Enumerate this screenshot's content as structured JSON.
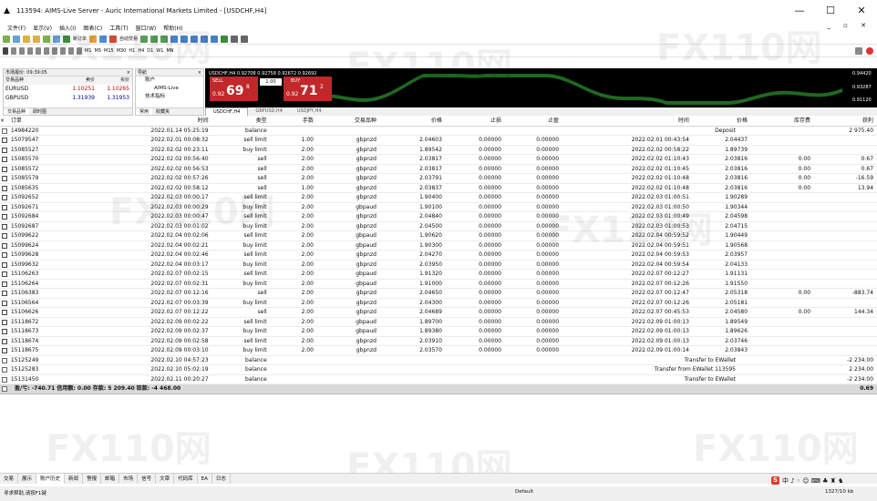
{
  "window": {
    "title": "113594: AIMS-Live Server - Auric International Markets Limited - [USDCHF,H4]",
    "controls": [
      "—",
      "☐",
      "✕"
    ]
  },
  "menu": {
    "items": [
      "文件(F)",
      "显示(V)",
      "插入(I)",
      "图表(C)",
      "工具(T)",
      "窗口(W)",
      "帮助(H)"
    ],
    "mdi": "_ ▫ ✕"
  },
  "toolbar": {
    "new_order": "新订单",
    "auto_trade": "自动交易",
    "timeframes": [
      "M1",
      "M5",
      "M15",
      "M30",
      "H1",
      "H4",
      "D1",
      "W1",
      "MN"
    ]
  },
  "market_watch": {
    "header": "市场报价: 09:39:05",
    "cols": [
      "交易品种",
      "卖价",
      "买价"
    ],
    "rows": [
      {
        "sym": "EURUSD",
        "bid": "1.10251",
        "ask": "1.10265"
      },
      {
        "sym": "GBPUSD",
        "bid": "1.31939",
        "ask": "1.31953"
      }
    ],
    "tabs": [
      "交易品种",
      "即时图"
    ]
  },
  "navigator": {
    "header": "导航",
    "items": [
      "AIMS-Live",
      "账户",
      "技术指标"
    ],
    "tabs": [
      "常用",
      "收藏夹"
    ]
  },
  "chart": {
    "info": "USDCHF,H4 0.92708 0.92758 0.92672 0.92692",
    "sell_label": "SELL",
    "buy_label": "BUY",
    "lot": "1.00",
    "sell_price_small": "0.92",
    "sell_price_big": "69",
    "sell_price_sup": "8",
    "buy_price_small": "0.92",
    "buy_price_big": "71",
    "buy_price_sup": "2",
    "price_labels": [
      "0.94420",
      "0.93287",
      "0.91120"
    ],
    "tabs": [
      "USDCHF,H4",
      "GBPUSD,H4",
      "USDJPY,H4"
    ]
  },
  "terminal": {
    "headers": {
      "order": "订单",
      "time1": "时间",
      "type": "类型",
      "lots": "手数",
      "symbol": "交易品种",
      "price": "价格",
      "sl": "止损",
      "tp": "止盈",
      "time2": "时间",
      "cprice": "价格",
      "swap": "库存费",
      "profit": "获利"
    },
    "rows": [
      {
        "order": "14984220",
        "t1": "2022.01.14 05:25:19",
        "type": "balance",
        "lots": "",
        "sym": "",
        "price": "",
        "sl": "",
        "tp": "",
        "t2": "",
        "cp": "",
        "sw": "",
        "pr": "2 975.40",
        "comment": "Deposit",
        "kind": "bal"
      },
      {
        "order": "15079547",
        "t1": "2022.02.01 00:08:32",
        "type": "sell limit",
        "lots": "1.00",
        "sym": "gbpnzd",
        "price": "2.04603",
        "sl": "0.00000",
        "tp": "0.00000",
        "t2": "2022.02.01 00:43:54",
        "cp": "2.04437",
        "sw": "",
        "pr": "",
        "comment": "",
        "kind": "ord"
      },
      {
        "order": "15085527",
        "t1": "2022.02.02 00:23:11",
        "type": "buy limit",
        "lots": "2.00",
        "sym": "gbpnzd",
        "price": "1.89542",
        "sl": "0.00000",
        "tp": "0.00000",
        "t2": "2022.02.02 00:58:22",
        "cp": "1.89739",
        "sw": "",
        "pr": "",
        "comment": "",
        "kind": "ord"
      },
      {
        "order": "15085570",
        "t1": "2022.02.02 00:56:40",
        "type": "sell",
        "lots": "2.00",
        "sym": "gbpnzd",
        "price": "2.03817",
        "sl": "0.00000",
        "tp": "0.00000",
        "t2": "2022.02.02 01:10:43",
        "cp": "2.03816",
        "sw": "0.00",
        "pr": "0.67",
        "comment": "",
        "kind": "ord"
      },
      {
        "order": "15085572",
        "t1": "2022.02.02 00:56:53",
        "type": "sell",
        "lots": "2.00",
        "sym": "gbpnzd",
        "price": "2.03817",
        "sl": "0.00000",
        "tp": "0.00000",
        "t2": "2022.02.02 01:10:45",
        "cp": "2.03816",
        "sw": "0.00",
        "pr": "0.67",
        "comment": "",
        "kind": "ord"
      },
      {
        "order": "15085579",
        "t1": "2022.02.02 00:57:26",
        "type": "sell",
        "lots": "2.00",
        "sym": "gbpnzd",
        "price": "2.03791",
        "sl": "0.00000",
        "tp": "0.00000",
        "t2": "2022.02.02 01:10:48",
        "cp": "2.03816",
        "sw": "0.00",
        "pr": "-16.59",
        "comment": "",
        "kind": "ord"
      },
      {
        "order": "15085635",
        "t1": "2022.02.02 00:58:12",
        "type": "sell",
        "lots": "1.00",
        "sym": "gbpnzd",
        "price": "2.03837",
        "sl": "0.00000",
        "tp": "0.00000",
        "t2": "2022.02.02 01:10:48",
        "cp": "2.03816",
        "sw": "0.00",
        "pr": "13.94",
        "comment": "",
        "kind": "ord"
      },
      {
        "order": "15092652",
        "t1": "2022.02.03 00:00:17",
        "type": "sell limit",
        "lots": "2.00",
        "sym": "gbpnzd",
        "price": "1.90400",
        "sl": "0.00000",
        "tp": "0.00000",
        "t2": "2022.02.03 01:00:51",
        "cp": "1.90289",
        "sw": "",
        "pr": "",
        "comment": "",
        "kind": "ord"
      },
      {
        "order": "15092671",
        "t1": "2022.02.03 00:00:29",
        "type": "buy limit",
        "lots": "2.00",
        "sym": "gbpaud",
        "price": "1.90100",
        "sl": "0.00000",
        "tp": "0.00000",
        "t2": "2022.02.03 01:00:50",
        "cp": "1.90344",
        "sw": "",
        "pr": "",
        "comment": "",
        "kind": "ord"
      },
      {
        "order": "15092684",
        "t1": "2022.02.03 00:00:47",
        "type": "sell limit",
        "lots": "2.00",
        "sym": "gbpnzd",
        "price": "2.04840",
        "sl": "0.00000",
        "tp": "0.00000",
        "t2": "2022.02.03 01:00:49",
        "cp": "2.04598",
        "sw": "",
        "pr": "",
        "comment": "",
        "kind": "ord"
      },
      {
        "order": "15092687",
        "t1": "2022.02.03 00:01:02",
        "type": "buy limit",
        "lots": "2.00",
        "sym": "gbpnzd",
        "price": "2.04500",
        "sl": "0.00000",
        "tp": "0.00000",
        "t2": "2022.02.03 01:00:53",
        "cp": "2.04715",
        "sw": "",
        "pr": "",
        "comment": "",
        "kind": "ord"
      },
      {
        "order": "15099622",
        "t1": "2022.02.04 00:02:06",
        "type": "sell limit",
        "lots": "2.00",
        "sym": "gbpaud",
        "price": "1.90620",
        "sl": "0.00000",
        "tp": "0.00000",
        "t2": "2022.02.04 00:59:52",
        "cp": "1.90449",
        "sw": "",
        "pr": "",
        "comment": "",
        "kind": "ord"
      },
      {
        "order": "15099624",
        "t1": "2022.02.04 00:02:21",
        "type": "buy limit",
        "lots": "2.00",
        "sym": "gbpaud",
        "price": "1.90300",
        "sl": "0.00000",
        "tp": "0.00000",
        "t2": "2022.02.04 00:59:51",
        "cp": "1.90568",
        "sw": "",
        "pr": "",
        "comment": "",
        "kind": "ord"
      },
      {
        "order": "15099628",
        "t1": "2022.02.04 00:02:46",
        "type": "sell limit",
        "lots": "2.00",
        "sym": "gbpnzd",
        "price": "2.04270",
        "sl": "0.00000",
        "tp": "0.00000",
        "t2": "2022.02.04 00:59:53",
        "cp": "2.03957",
        "sw": "",
        "pr": "",
        "comment": "",
        "kind": "ord"
      },
      {
        "order": "15099632",
        "t1": "2022.02.04 00:03:17",
        "type": "buy limit",
        "lots": "2.00",
        "sym": "gbpnzd",
        "price": "2.03950",
        "sl": "0.00000",
        "tp": "0.00000",
        "t2": "2022.02.04 00:59:54",
        "cp": "2.04133",
        "sw": "",
        "pr": "",
        "comment": "",
        "kind": "ord"
      },
      {
        "order": "15106263",
        "t1": "2022.02.07 00:02:15",
        "type": "sell limit",
        "lots": "2.00",
        "sym": "gbpaud",
        "price": "1.91320",
        "sl": "0.00000",
        "tp": "0.00000",
        "t2": "2022.02.07 00:12:27",
        "cp": "1.91131",
        "sw": "",
        "pr": "",
        "comment": "",
        "kind": "ord"
      },
      {
        "order": "15106264",
        "t1": "2022.02.07 00:02:31",
        "type": "buy limit",
        "lots": "2.00",
        "sym": "gbpaud",
        "price": "1.91000",
        "sl": "0.00000",
        "tp": "0.00000",
        "t2": "2022.02.07 00:12:26",
        "cp": "1.91550",
        "sw": "",
        "pr": "",
        "comment": "",
        "kind": "ord"
      },
      {
        "order": "15106383",
        "t1": "2022.02.07 00:12:16",
        "type": "sell",
        "lots": "2.00",
        "sym": "gbpnzd",
        "price": "2.04650",
        "sl": "0.00000",
        "tp": "0.00000",
        "t2": "2022.02.07 00:12:47",
        "cp": "2.05318",
        "sw": "0.00",
        "pr": "-883.74",
        "comment": "",
        "kind": "ord"
      },
      {
        "order": "15106564",
        "t1": "2022.02.07 00:03:39",
        "type": "buy limit",
        "lots": "2.00",
        "sym": "gbpnzd",
        "price": "2.04300",
        "sl": "0.00000",
        "tp": "0.00000",
        "t2": "2022.02.07 00:12:26",
        "cp": "2.05181",
        "sw": "",
        "pr": "",
        "comment": "",
        "kind": "ord"
      },
      {
        "order": "15106626",
        "t1": "2022.02.07 00:12:22",
        "type": "sell",
        "lots": "2.00",
        "sym": "gbpnzd",
        "price": "2.04689",
        "sl": "0.00000",
        "tp": "0.00000",
        "t2": "2022.02.07 00:45:53",
        "cp": "2.04580",
        "sw": "0.00",
        "pr": "144.34",
        "comment": "",
        "kind": "ord"
      },
      {
        "order": "15118672",
        "t1": "2022.02.09 00:02:22",
        "type": "sell limit",
        "lots": "2.00",
        "sym": "gbpaud",
        "price": "1.89700",
        "sl": "0.00000",
        "tp": "0.00000",
        "t2": "2022.02.09 01:00:13",
        "cp": "1.89549",
        "sw": "",
        "pr": "",
        "comment": "",
        "kind": "ord"
      },
      {
        "order": "15118673",
        "t1": "2022.02.09 00:02:37",
        "type": "buy limit",
        "lots": "2.00",
        "sym": "gbpaud",
        "price": "1.89380",
        "sl": "0.00000",
        "tp": "0.00000",
        "t2": "2022.02.09 01:00:13",
        "cp": "1.89626",
        "sw": "",
        "pr": "",
        "comment": "",
        "kind": "ord"
      },
      {
        "order": "15118674",
        "t1": "2022.02.09 00:02:58",
        "type": "sell limit",
        "lots": "2.00",
        "sym": "gbpnzd",
        "price": "2.03910",
        "sl": "0.00000",
        "tp": "0.00000",
        "t2": "2022.02.09 01:00:13",
        "cp": "2.03746",
        "sw": "",
        "pr": "",
        "comment": "",
        "kind": "ord"
      },
      {
        "order": "15118675",
        "t1": "2022.02.09 00:03:10",
        "type": "buy limit",
        "lots": "2.00",
        "sym": "gbpnzd",
        "price": "2.03570",
        "sl": "0.00000",
        "tp": "0.00000",
        "t2": "2022.02.09 01:00:14",
        "cp": "2.03843",
        "sw": "",
        "pr": "",
        "comment": "",
        "kind": "ord"
      },
      {
        "order": "15125249",
        "t1": "2022.02.10 04:57:23",
        "type": "balance",
        "lots": "",
        "sym": "",
        "price": "",
        "sl": "",
        "tp": "",
        "t2": "",
        "cp": "",
        "sw": "",
        "pr": "-2 234.00",
        "comment": "Transfer to EWallet",
        "kind": "bal"
      },
      {
        "order": "15125283",
        "t1": "2022.02.10 05:02:19",
        "type": "balance",
        "lots": "",
        "sym": "",
        "price": "",
        "sl": "",
        "tp": "",
        "t2": "",
        "cp": "",
        "sw": "",
        "pr": "2 234.00",
        "comment": "Transfer from EWallet 113595",
        "kind": "bal"
      },
      {
        "order": "15131450",
        "t1": "2022.02.11 00:20:27",
        "type": "balance",
        "lots": "",
        "sym": "",
        "price": "",
        "sl": "",
        "tp": "",
        "t2": "",
        "cp": "",
        "sw": "",
        "pr": "-2 234.00",
        "comment": "Transfer to EWallet",
        "kind": "bal"
      }
    ],
    "summary": {
      "text": "盈/亏: -740.71  信用额: 0.00  存款: 5 209.40  取款: -4 468.00",
      "profit": "0.69"
    }
  },
  "bottom_tabs": [
    "交易",
    "展示",
    "账户历史",
    "新闻",
    "警报",
    "邮箱",
    "市场",
    "信号",
    "文章",
    "代码库",
    "EA",
    "日志"
  ],
  "bottom_tabs_active": 2,
  "status": {
    "help": "寻求帮助,请按F1键",
    "profile": "Default",
    "conn": "1327/10 kb"
  },
  "ime": "中 ♪ ◦ ☺ ⌨ ♣ ♜ ♞",
  "watermark": "FX110网",
  "chart_data": {
    "type": "table",
    "columns": [
      "订单",
      "时间",
      "类型",
      "手数",
      "交易品种",
      "价格",
      "止损",
      "止盈",
      "时间",
      "价格",
      "库存费",
      "获利"
    ],
    "rows_ref": "terminal.rows"
  }
}
